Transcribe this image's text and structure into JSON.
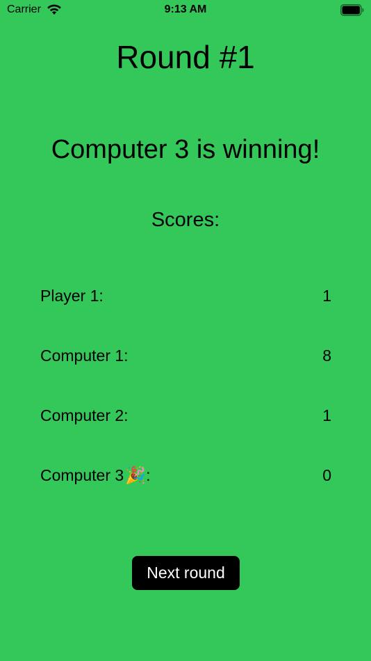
{
  "status_bar": {
    "carrier": "Carrier",
    "time": "9:13 AM",
    "wifi_icon": "wifi-icon",
    "battery_icon": "battery-icon"
  },
  "title": "Round #1",
  "winner_message": "Computer 3 is winning!",
  "scores_heading": "Scores:",
  "scores": [
    {
      "name": "Player 1",
      "score": "1"
    },
    {
      "name": "Computer 1",
      "score": "8"
    },
    {
      "name": "Computer 2",
      "score": "1"
    },
    {
      "name": "Computer 3",
      "badge": "🎉",
      "score": "0"
    }
  ],
  "colon": ":",
  "next_button_label": "Next round",
  "colors": {
    "background": "#34C759",
    "button": "#000000",
    "button_text": "#FFFFFF"
  }
}
